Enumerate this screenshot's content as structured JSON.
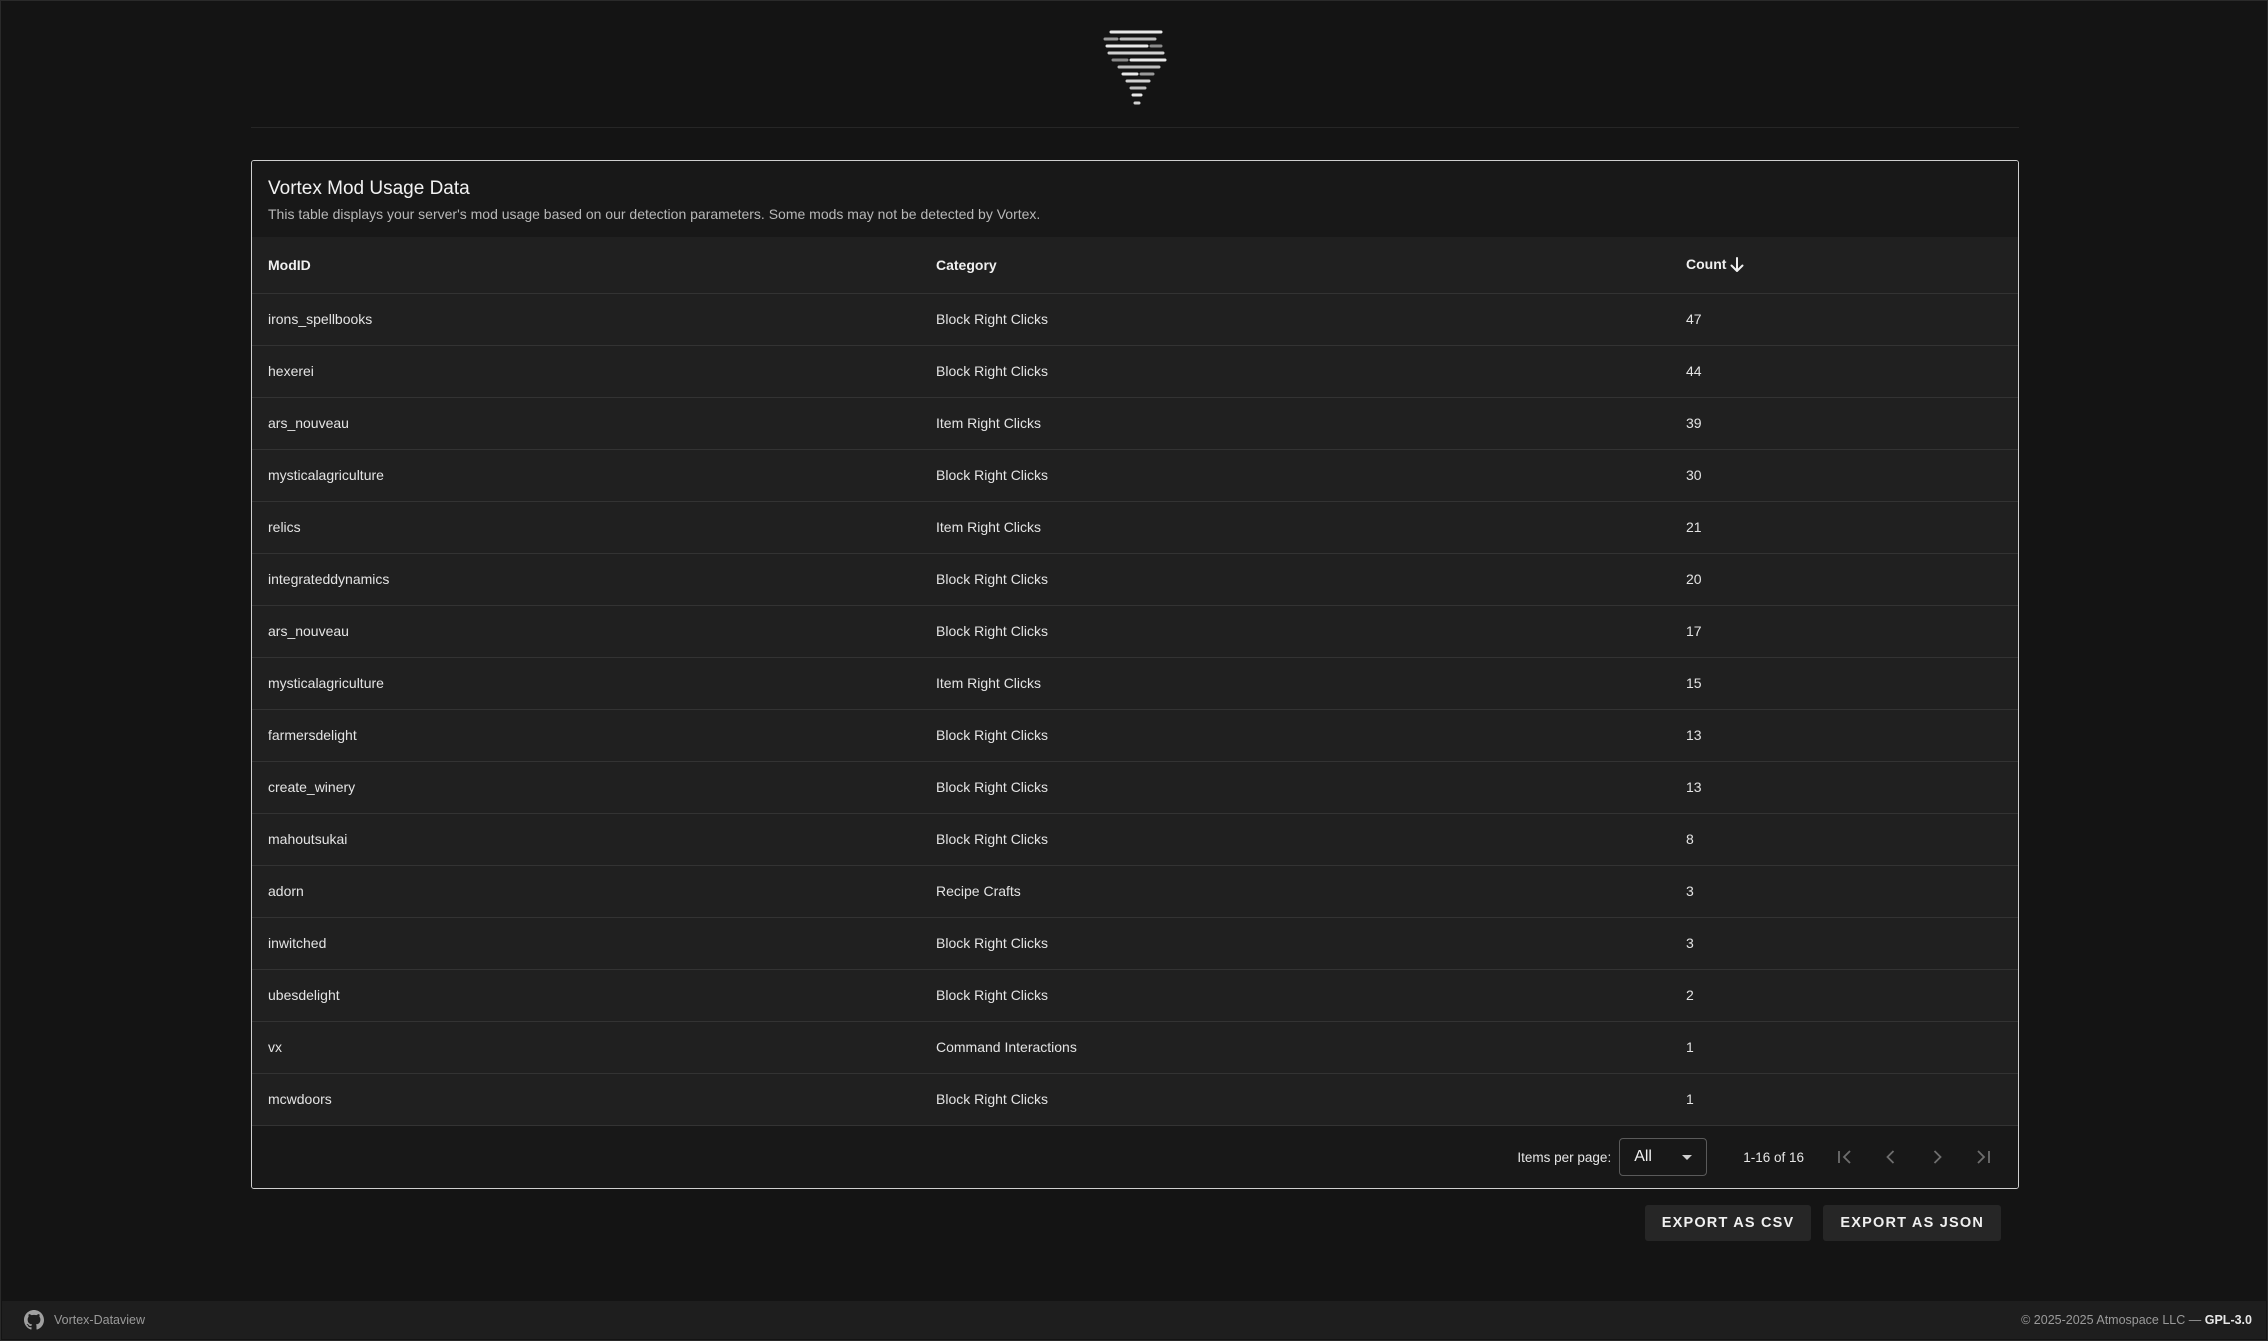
{
  "card": {
    "title": "Vortex Mod Usage Data",
    "subtitle": "This table displays your server's mod usage based on our detection parameters. Some mods may not be detected by Vortex."
  },
  "table": {
    "headers": {
      "modid": "ModID",
      "category": "Category",
      "count": "Count"
    },
    "sort": {
      "column": "Count",
      "direction": "descending",
      "icon": "arrow-down-icon"
    },
    "rows": [
      {
        "modid": "irons_spellbooks",
        "category": "Block Right Clicks",
        "count": "47"
      },
      {
        "modid": "hexerei",
        "category": "Block Right Clicks",
        "count": "44"
      },
      {
        "modid": "ars_nouveau",
        "category": "Item Right Clicks",
        "count": "39"
      },
      {
        "modid": "mysticalagriculture",
        "category": "Block Right Clicks",
        "count": "30"
      },
      {
        "modid": "relics",
        "category": "Item Right Clicks",
        "count": "21"
      },
      {
        "modid": "integrateddynamics",
        "category": "Block Right Clicks",
        "count": "20"
      },
      {
        "modid": "ars_nouveau",
        "category": "Block Right Clicks",
        "count": "17"
      },
      {
        "modid": "mysticalagriculture",
        "category": "Item Right Clicks",
        "count": "15"
      },
      {
        "modid": "farmersdelight",
        "category": "Block Right Clicks",
        "count": "13"
      },
      {
        "modid": "create_winery",
        "category": "Block Right Clicks",
        "count": "13"
      },
      {
        "modid": "mahoutsukai",
        "category": "Block Right Clicks",
        "count": "8"
      },
      {
        "modid": "adorn",
        "category": "Recipe Crafts",
        "count": "3"
      },
      {
        "modid": "inwitched",
        "category": "Block Right Clicks",
        "count": "3"
      },
      {
        "modid": "ubesdelight",
        "category": "Block Right Clicks",
        "count": "2"
      },
      {
        "modid": "vx",
        "category": "Command Interactions",
        "count": "1"
      },
      {
        "modid": "mcwdoors",
        "category": "Block Right Clicks",
        "count": "1"
      }
    ]
  },
  "pagination": {
    "items_per_page_label": "Items per page:",
    "items_per_page_value": "All",
    "range": "1-16 of 16"
  },
  "actions": {
    "export_csv": "EXPORT AS CSV",
    "export_json": "EXPORT AS JSON"
  },
  "footer": {
    "repo": "Vortex-Dataview",
    "copyright": "© 2025-2025 Atmospace LLC —",
    "license": "GPL-3.0"
  },
  "icons": [
    "vortex-logo-icon",
    "arrow-down-icon",
    "first-page-icon",
    "prev-page-icon",
    "next-page-icon",
    "last-page-icon",
    "github-icon",
    "caret-down-icon"
  ],
  "colors": {
    "background": "#141414",
    "card": "#181818",
    "row": "#202020",
    "border": "#cfcfcf"
  }
}
